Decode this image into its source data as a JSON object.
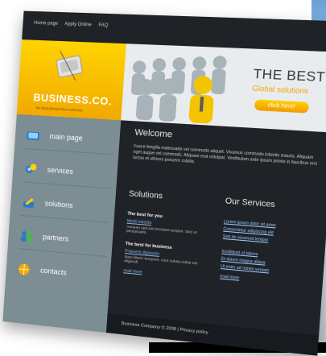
{
  "topbar": {
    "home": "Home page",
    "apply": "Apply Online",
    "faq": "FAQ"
  },
  "logo": {
    "brand": "BUSINESS.CO.",
    "tagline": "the best perspective solutions"
  },
  "hero": {
    "headline": "THE BEST",
    "subheadline": "Global solutions",
    "cta": "click here!"
  },
  "sidebar": {
    "items": [
      {
        "label": "main page",
        "icon": "blue-book-icon"
      },
      {
        "label": "services",
        "icon": "gear-icon"
      },
      {
        "label": "solutions",
        "icon": "pen-icon"
      },
      {
        "label": "partners",
        "icon": "people-icon"
      },
      {
        "label": "contacts",
        "icon": "globe-icon"
      }
    ]
  },
  "welcome": {
    "title": "Welcome",
    "text": "Fusce fringilla malesuada vel commodo aliquet. Vivamus commodo lobortis mauris. Aliquam eget augue vel commodo. Aliquam erat volutpat. Vestibulum ante ipsum primis in faucibus orci luctus et ultrices posuere cubilia."
  },
  "solutions": {
    "title": "Solutions",
    "block1_title": "The best for you",
    "block1_link": "Morbi lobortis",
    "block1_text": "Aenean sed est tincidunt tempor. Sed ut perspiciatis.",
    "block2_title": "The best for business",
    "block2_link": "Praesent dignissim",
    "block2_text": "Nam libero tempore, cum soluta nobis est eligendi.",
    "read_more": "read more"
  },
  "services": {
    "title": "Our Services",
    "list1": [
      "Lorem ipsum dolor sit amet",
      "Consectetur adipiscing elit",
      "Sed do eiusmod tempor"
    ],
    "list2": [
      "Incididunt ut labore",
      "Et dolore magna aliqua",
      "Ut enim ad minim veniam"
    ],
    "read_more": "read more"
  },
  "footer": {
    "text": "Business Company © 2008  |  Privacy policy"
  }
}
